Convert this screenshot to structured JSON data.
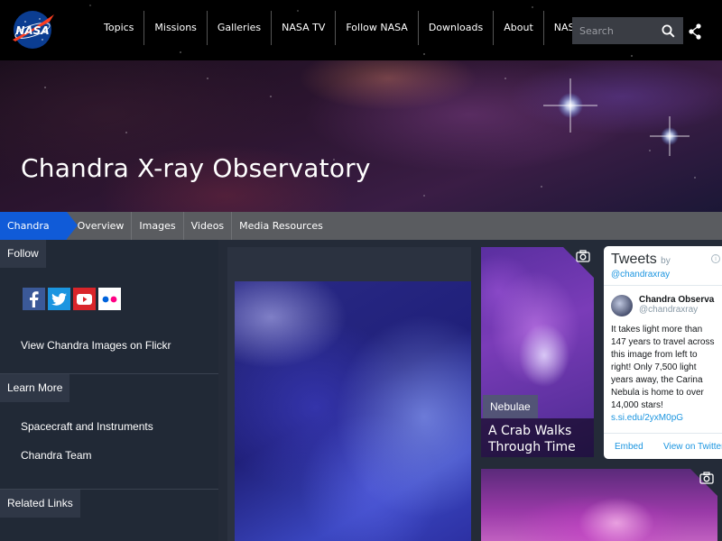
{
  "header": {
    "nav": [
      "Topics",
      "Missions",
      "Galleries",
      "NASA TV",
      "Follow NASA",
      "Downloads",
      "About",
      "NASA Audiences"
    ],
    "search_placeholder": "Search"
  },
  "hero": {
    "title": "Chandra X-ray Observatory"
  },
  "subnav": {
    "active": "Chandra",
    "items": [
      "Overview",
      "Images",
      "Videos",
      "Media Resources"
    ]
  },
  "sidebar": {
    "follow": {
      "heading": "Follow",
      "link": "View Chandra Images on Flickr"
    },
    "learn_more": {
      "heading": "Learn More",
      "links": [
        "Spacecraft and Instruments",
        "Chandra Team"
      ]
    },
    "related": {
      "heading": "Related Links"
    }
  },
  "cards": {
    "feature": {
      "tag": "Nebulae",
      "title": "A Crab Walks Through Time"
    }
  },
  "tweets": {
    "title": "Tweets",
    "by": "by",
    "handle": "@chandraxray",
    "user_name": "Chandra Observa",
    "user_handle": "@chandraxray",
    "text": "It takes light more than 147 years to travel across this image from left to right! Only 7,500 light years away, the Carina Nebula is home to over 14,000 stars!",
    "link": "s.si.edu/2yxM0pG",
    "embed": "Embed",
    "view_on": "View on Twitter"
  },
  "colors": {
    "nav_bg": "#000000",
    "subnav_active": "#105bd8",
    "sidebar_bg": "#212936",
    "twitter_link": "#1b95e0"
  },
  "icons": [
    "nasa-logo",
    "search-icon",
    "share-icon",
    "facebook-icon",
    "twitter-icon",
    "youtube-icon",
    "flickr-icon",
    "camera-icon"
  ]
}
